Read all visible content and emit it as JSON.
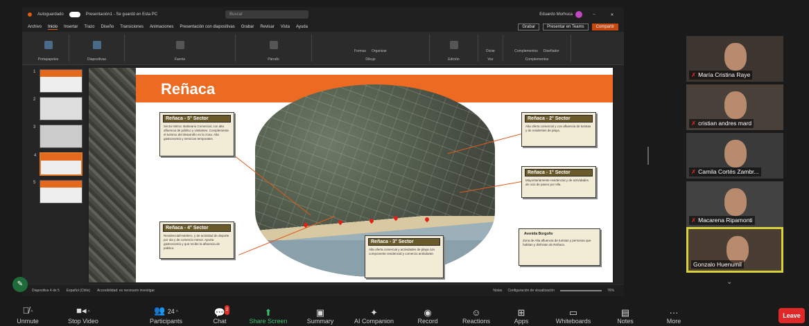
{
  "app": {
    "autosave_label": "Autoguardado",
    "doc_title": "Presentación1 - Se guardó en Esta PC",
    "search_placeholder": "Buscar",
    "user_name": "Eduardo Morhuca",
    "menu": [
      "Archivo",
      "Inicio",
      "Insertar",
      "Trazo",
      "Diseño",
      "Transiciones",
      "Animaciones",
      "Presentación con diapositivas",
      "Grabar",
      "Revisar",
      "Vista",
      "Ayuda"
    ],
    "menu_active": "Inicio",
    "buttons": {
      "record": "Grabar",
      "present": "Presentar en Teams",
      "share": "Compartir"
    },
    "ribbon_groups": [
      "Portapapeles",
      "Diapositivas",
      "Fuente",
      "Párrafo",
      "Dibujo",
      "Edición",
      "Voz",
      "Complementos"
    ],
    "ribbon_tools": {
      "shapes": "Formas",
      "arrange": "Organizar",
      "dictate": "Dictar",
      "addins": "Complementos",
      "designer": "Diseñador"
    }
  },
  "thumbs": [
    "1",
    "2",
    "3",
    "4",
    "5"
  ],
  "slide": {
    "title": "Reñaca",
    "boxes": {
      "s5": {
        "title": "Reñaca - 5° Sector",
        "text": "Sector Mirror. Balneario Comercial, con alta afluencia de público y visitantes. Complementa el turismo del desarrollo en la zona. Alta gastronomía y servicios temporales."
      },
      "s2": {
        "title": "Reñaca - 2° Sector",
        "text": "Alta oferta comercial y con afluencia de turistas y de residentes de playa."
      },
      "s1": {
        "title": "Reñaca - 1° Sector",
        "text": "Mayoritariamente residencial y de actividades de ocio de paseo por ella."
      },
      "s4": {
        "title": "Reñaca - 4° Sector",
        "text": "Residencial/Hotelero, y de actividad de deporte por ola y de comercio menor. Aporta gastronomía y que recibe la afluencia de público."
      },
      "s3": {
        "title": "Reñaca - 3° Sector",
        "text": "Alta oferta comercial y actividades de playa con componente residencial y comercio ambulante."
      },
      "av": {
        "title": "Avenida Borgoño",
        "text": "Zona de Alta afluencia de turistas y personas que habitan y disfrutan de Reñaca."
      }
    }
  },
  "status": {
    "slide_info": "Diapositiva 4 de 5",
    "language": "Español (Chile)",
    "accessibility": "Accesibilidad: es necesario investigar",
    "notes": "Notas",
    "view_settings": "Configuración de visualización",
    "zoom": "76%"
  },
  "participants": [
    {
      "name": "María Cristina Raye",
      "muted": true
    },
    {
      "name": "cristian andres mard",
      "muted": true
    },
    {
      "name": "Camila Cortés Zambr...",
      "muted": true
    },
    {
      "name": "Macarena Ripamonti",
      "muted": true
    },
    {
      "name": "Gonzalo Huenumil",
      "muted": false
    }
  ],
  "toolbar": {
    "unmute": "Unmute",
    "stop_video": "Stop Video",
    "participants": "Participants",
    "participants_count": "24",
    "chat": "Chat",
    "chat_badge": "2",
    "share_screen": "Share Screen",
    "summary": "Summary",
    "ai_companion": "AI Companion",
    "record": "Record",
    "reactions": "Reactions",
    "apps": "Apps",
    "whiteboards": "Whiteboards",
    "notes": "Notes",
    "more": "More",
    "leave": "Leave"
  },
  "colors": {
    "accent": "#ec6a22",
    "leave": "#e02828",
    "share": "#3ac06a",
    "speaker": "#d9d23a"
  }
}
